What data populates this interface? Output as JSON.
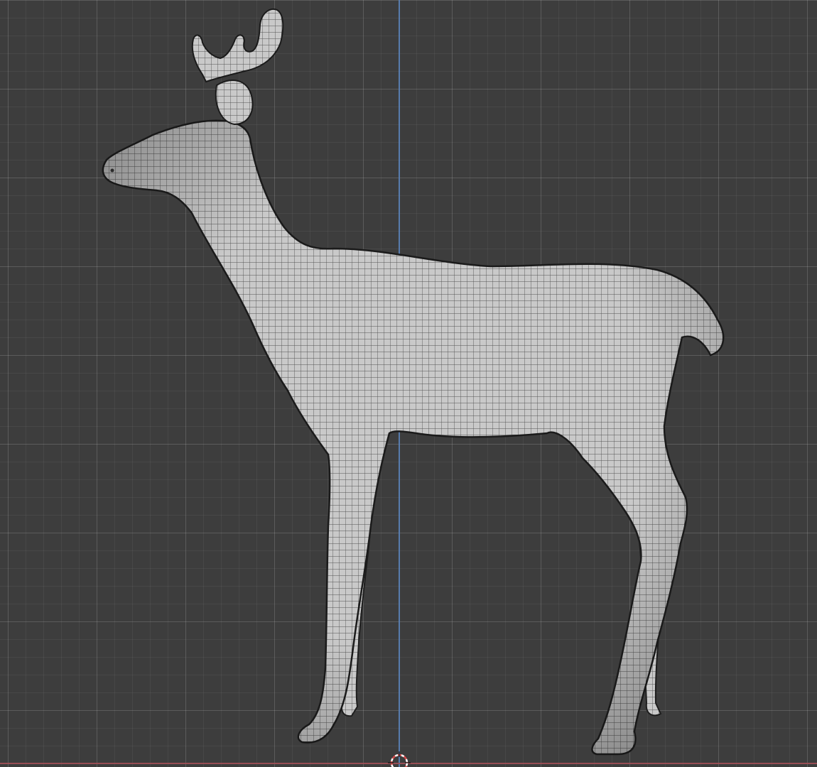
{
  "viewport": {
    "view": "side-orthographic",
    "background_color": "#3d3d3d",
    "grid_color": "#555555",
    "axis_x_color": "#a14f57",
    "axis_z_color": "#5a82b8"
  },
  "object": {
    "subject": "deer",
    "display": "solid-with-wireframe",
    "surface_color": "#c9c9c9",
    "wire_color": "#2b2b2b"
  },
  "cursor_3d": {
    "icon": "3d-cursor-icon",
    "ring_colors": [
      "#d64b4b",
      "#ffffff"
    ]
  }
}
